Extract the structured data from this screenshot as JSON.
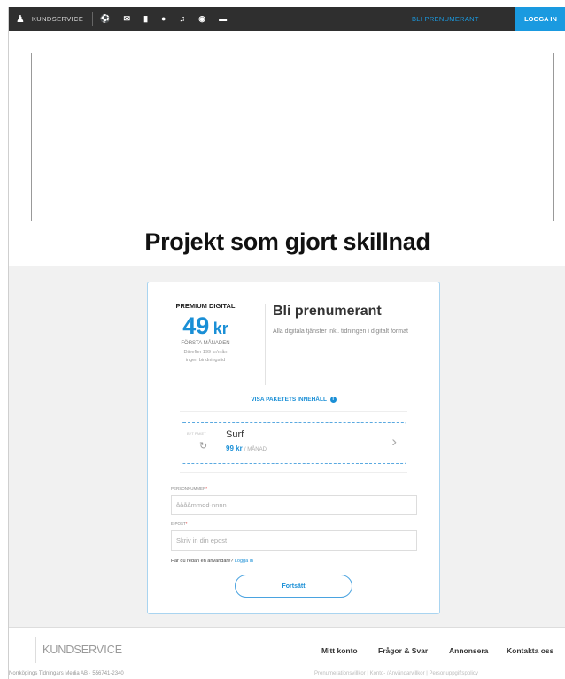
{
  "topbar": {
    "customer_service": "KUNDSERVICE",
    "subscribe": "BLI PRENUMERANT",
    "login": "LOGGA IN"
  },
  "headline": "Projekt som gjort skillnad",
  "offer": {
    "product": "PREMIUM DIGITAL",
    "price_number": "49",
    "price_unit": "kr",
    "price_period": "FÖRSTA MÅNADEN",
    "price_note_1": "Därefter 199 kr/mån",
    "price_note_2": "ingen bindningstid",
    "heading": "Bli prenumerant",
    "description": "Alla digitala tjänster inkl. tidningen i digitalt format",
    "view_contents": "VISA PAKETETS INNEHÅLL"
  },
  "package": {
    "tag": "BYT PAKET",
    "name": "Surf",
    "price": "99 kr",
    "period": "/ MÅNAD"
  },
  "form": {
    "personal_number_label": "PERSONNUMMER",
    "personal_number_placeholder": "ååååmmdd-nnnn",
    "email_label": "E-POST",
    "email_placeholder": "Skriv in din epost",
    "already_user": "Har du redan en användare?",
    "login_link": "Logga in",
    "submit": "Fortsätt"
  },
  "footer": {
    "title": "KUNDSERVICE",
    "links": [
      "Mitt konto",
      "Frågor & Svar",
      "Annonsera",
      "Kontakta oss"
    ],
    "company": "Norrköpings Tidningars Media AB · 556741-2340",
    "legal": "Prenumerationsvillkor | Konto- /Användarvillkor | Personuppgiftspolicy"
  },
  "colors": {
    "accent": "#1a9ae0",
    "topbar_bg": "#2f2f2f"
  }
}
